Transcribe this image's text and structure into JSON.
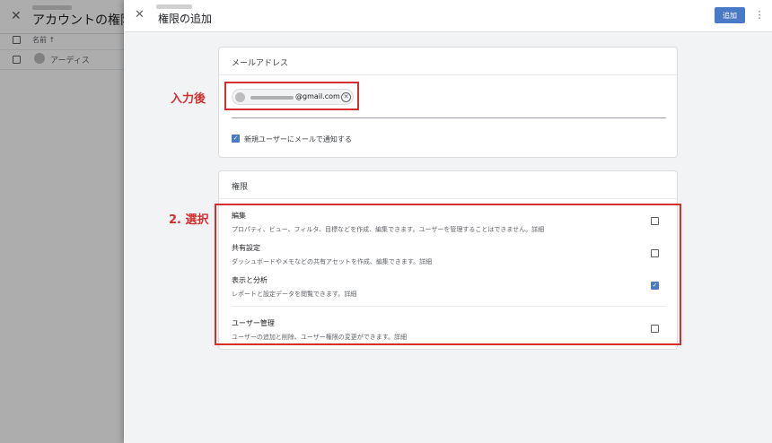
{
  "background": {
    "close_icon": "close-icon",
    "title": "アカウントの権限",
    "column_header": "名前 ↑",
    "user_name": "アーディス"
  },
  "dialog": {
    "title": "権限の追加",
    "add_button": "追加",
    "more_icon": "more-vert-icon",
    "email_card": {
      "title": "メールアドレス",
      "chip_email": "@gmail.com",
      "notify_label": "新規ユーザーにメールで通知する",
      "notify_checked": true
    },
    "permissions_card": {
      "title": "権限",
      "items": [
        {
          "name": "編集",
          "desc": "プロパティ、ビュー、フィルタ、目標などを作成、編集できます。ユーザーを管理することはできません。",
          "link": "詳細",
          "checked": false
        },
        {
          "name": "共有設定",
          "desc": "ダッシュボードやメモなどの共有アセットを作成、編集できます。",
          "link": "詳細",
          "checked": false
        },
        {
          "name": "表示と分析",
          "desc": "レポートと設定データを閲覧できます。",
          "link": "詳細",
          "checked": true
        },
        {
          "name": "ユーザー管理",
          "desc": "ユーザーの追加と削除、ユーザー権限の変更ができます。",
          "link": "詳細",
          "checked": false
        }
      ]
    }
  },
  "annotations": {
    "after_input": "入力後",
    "select": "2. 選択",
    "color": "#d32f2f"
  }
}
